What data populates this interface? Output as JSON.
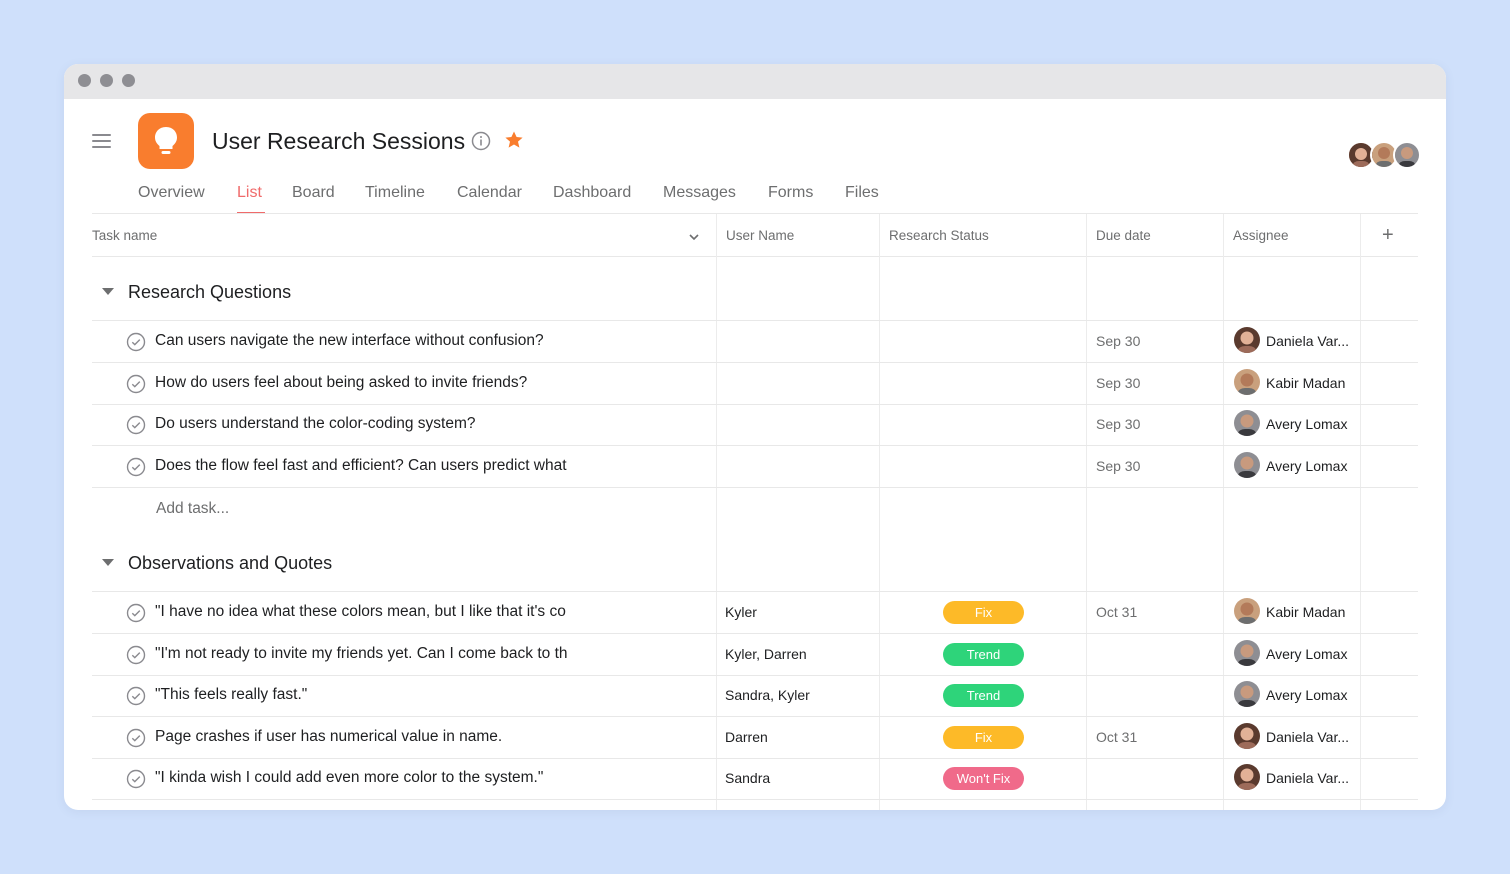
{
  "project": {
    "title": "User Research Sessions",
    "accent_color": "#f06a6a",
    "icon_color": "#f97d2e",
    "icon": "lightbulb-icon"
  },
  "tabs": [
    {
      "label": "Overview",
      "active": false
    },
    {
      "label": "List",
      "active": true
    },
    {
      "label": "Board",
      "active": false
    },
    {
      "label": "Timeline",
      "active": false
    },
    {
      "label": "Calendar",
      "active": false
    },
    {
      "label": "Dashboard",
      "active": false
    },
    {
      "label": "Messages",
      "active": false
    },
    {
      "label": "Forms",
      "active": false
    },
    {
      "label": "Files",
      "active": false
    }
  ],
  "columns": {
    "task_name": "Task name",
    "user_name": "User Name",
    "research_status": "Research Status",
    "due_date": "Due date",
    "assignee": "Assignee",
    "add": "+"
  },
  "sections": [
    {
      "title": "Research Questions",
      "rows": [
        {
          "task": "Can users navigate the new interface without confusion?",
          "user_name": "",
          "status": "",
          "due": "Sep 30",
          "assignee": "Daniela Var..."
        },
        {
          "task": "How do users feel about being asked to invite friends?",
          "user_name": "",
          "status": "",
          "due": "Sep 30",
          "assignee": "Kabir Madan"
        },
        {
          "task": "Do users understand the color-coding system?",
          "user_name": "",
          "status": "",
          "due": "Sep 30",
          "assignee": "Avery Lomax"
        },
        {
          "task": "Does the flow feel fast and efficient? Can users predict what",
          "user_name": "",
          "status": "",
          "due": "Sep 30",
          "assignee": "Avery Lomax"
        }
      ],
      "add_task": "Add task..."
    },
    {
      "title": "Observations and Quotes",
      "rows": [
        {
          "task": "\"I have no idea what these colors mean, but I like that it's co",
          "user_name": "Kyler",
          "status": "Fix",
          "due": "Oct 31",
          "assignee": "Kabir Madan"
        },
        {
          "task": "\"I'm not ready to invite my friends yet. Can I come back to th",
          "user_name": "Kyler, Darren",
          "status": "Trend",
          "due": "",
          "assignee": "Avery Lomax"
        },
        {
          "task": "\"This feels really fast.\"",
          "user_name": "Sandra, Kyler",
          "status": "Trend",
          "due": "",
          "assignee": "Avery Lomax"
        },
        {
          "task": "Page crashes if user has numerical value in name.",
          "user_name": "Darren",
          "status": "Fix",
          "due": "Oct 31",
          "assignee": "Daniela Var..."
        },
        {
          "task": "\"I kinda wish I could add even more color to the system.\"",
          "user_name": "Sandra",
          "status": "Won't Fix",
          "due": "",
          "assignee": "Daniela Var..."
        }
      ]
    }
  ],
  "status_colors": {
    "Fix": "#fdba28",
    "Trend": "#2ed47a",
    "Won't Fix": "#f06a8a"
  }
}
